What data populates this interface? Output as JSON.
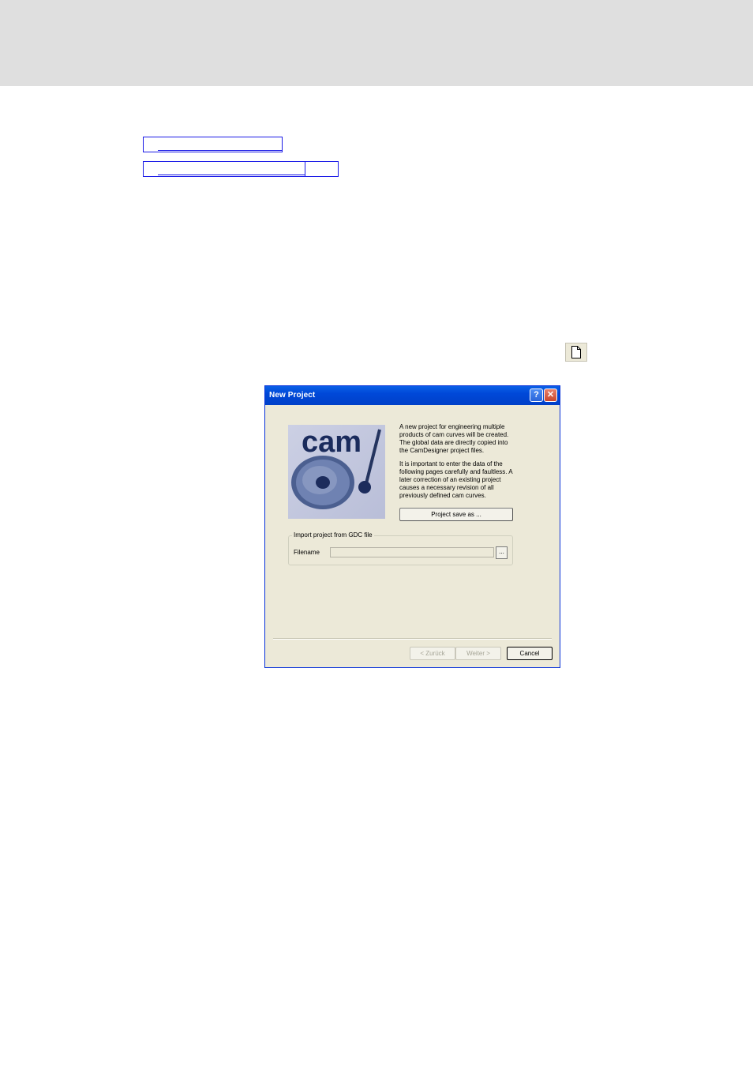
{
  "toolbar": {
    "new_project_icon": "new-document-icon"
  },
  "dialog": {
    "title": "New Project",
    "help_glyph": "?",
    "close_glyph": "✕",
    "logo_text": "cam",
    "description_1": "A new project for engineering multiple products of cam curves will be created. The global data are directly copied into the CamDesigner project files.",
    "description_2": "It is important to enter the data of the following pages carefully and faultless. A later correction of an existing project causes a necessary revision of all previously defined cam curves.",
    "save_as_label": "Project save as ...",
    "import_group": {
      "legend": "Import project from GDC file",
      "filename_label": "Filename",
      "filename_value": "",
      "browse_label": "..."
    },
    "buttons": {
      "back": "< Zurück",
      "next": "Weiter >",
      "cancel": "Cancel"
    }
  },
  "colors": {
    "titlebar": "#0048d8",
    "dialog_bg": "#ece9d8",
    "link_border": "#1a1ae6"
  }
}
